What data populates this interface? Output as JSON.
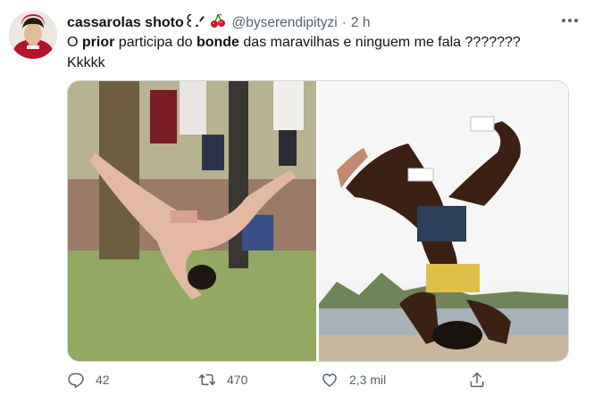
{
  "tweet": {
    "display_name": "cassarolas shoto",
    "name_suffix": "꒰.ᐟ",
    "handle": "@byserendipityzi",
    "separator": "·",
    "time": "2 h",
    "text_parts": [
      "O ",
      "prior",
      " participa do ",
      "bonde",
      " das maravilhas e ninguem me fala ???????"
    ],
    "text_line2": "Kkkkk"
  },
  "icons": {
    "avatar": "avatar",
    "cherry": "cherry-emoji-icon",
    "more": "more-options-icon",
    "reply": "reply-icon",
    "retweet": "retweet-icon",
    "like": "like-icon",
    "share": "share-icon"
  },
  "actions": {
    "reply_count": "42",
    "retweet_count": "470",
    "like_count": "2,3 mil"
  },
  "colors": {
    "text": "#0f1419",
    "secondary": "#536471",
    "border": "#cfd9de"
  }
}
